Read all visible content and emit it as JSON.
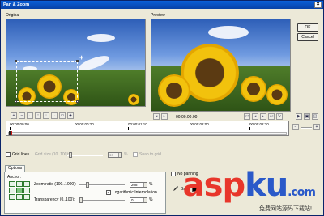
{
  "window": {
    "title": "Pan & Zoom"
  },
  "buttons": {
    "ok": "OK",
    "cancel": "Cancel"
  },
  "panels": {
    "original": "Original",
    "preview": "Preview"
  },
  "timecode": "00:00:00:00",
  "timeline": {
    "labels": [
      "00:00:00:00",
      "00:00:00:20",
      "00:00:01:10",
      "00:00:02:00",
      "00:00:02:20"
    ],
    "playhead_fraction": 0.0
  },
  "grid": {
    "grid_lines": "Grid lines",
    "grid_size_label": "Grid size (10..100):",
    "grid_size_value": "10",
    "grid_size_unit": "%",
    "snap_to_grid": "Snap to grid"
  },
  "options": {
    "tab_label": "Options",
    "anchor_label": "Anchor:",
    "zoom_label": "Zoom ratio (100..1000):",
    "zoom_value": "208",
    "zoom_unit": "%",
    "log_interp": "Logarithmic Interpolation",
    "transparency_label": "Transparency (0..100):",
    "transparency_value": "0",
    "transparency_unit": "%",
    "no_panning": "No panning",
    "background_label": "Bac"
  },
  "watermark": {
    "main_a": "asp",
    "main_b": "ku",
    "tld": ".com",
    "sub": "免费网站源码下载站!"
  },
  "colors": {
    "title_bar": "#0a5fd8",
    "window_bg": "#ece9d8",
    "keyframe": "#c81414"
  }
}
